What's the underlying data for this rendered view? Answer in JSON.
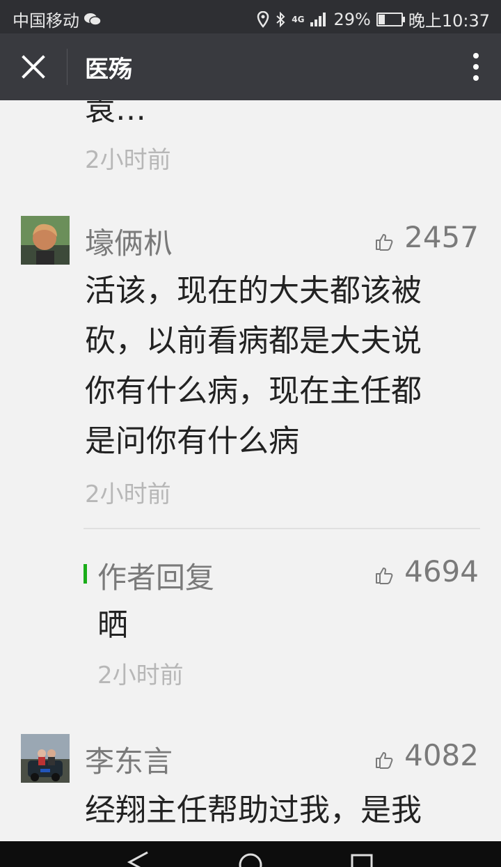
{
  "status_bar": {
    "carrier": "中国移动",
    "network": "4G",
    "battery_percent": "29%",
    "battery_level": 0.29,
    "time": "晚上10:37"
  },
  "titlebar": {
    "title": "医殇"
  },
  "comments": [
    {
      "text_tail": "袁…",
      "time": "2小时前"
    },
    {
      "name": "壕俩朳",
      "likes": "2457",
      "lines": [
        "活该，现在的大夫都该被",
        "砍，以前看病都是大夫说",
        "你有什么病，现在主任都",
        "是问你有什么病"
      ],
      "time": "2小时前",
      "reply": {
        "label": "作者回复",
        "likes": "4694",
        "text": "晒",
        "time": "2小时前"
      }
    },
    {
      "name": "李东言",
      "likes": "4082",
      "lines": [
        "经翔主任帮助过我，是我"
      ]
    }
  ],
  "colors": {
    "status_bg": "#2e2f33",
    "titlebar_bg": "#393a3f",
    "page_bg": "#f2f2f2",
    "accent_green": "#1aad19"
  }
}
